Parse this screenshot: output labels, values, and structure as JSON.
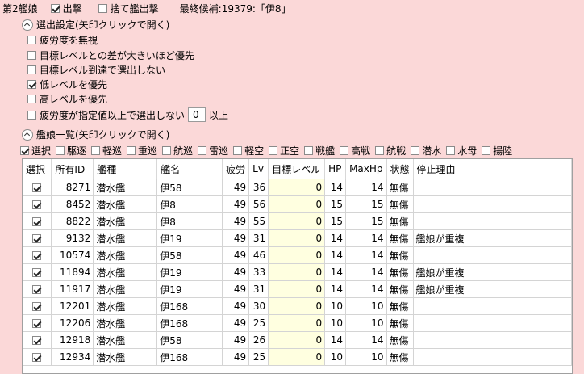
{
  "header": {
    "fleet_label": "第2艦娘",
    "sortie_label": "出撃",
    "sortie_checked": true,
    "sacrifice_label": "捨て艦出撃",
    "sacrifice_checked": false,
    "final_candidate": "最終候補:19379:「伊8」"
  },
  "selection_settings": {
    "title": "選出設定(矢印クリックで開く)",
    "options": [
      {
        "label": "疲労度を無視",
        "checked": false
      },
      {
        "label": "目標レベルとの差が大きいほど優先",
        "checked": false
      },
      {
        "label": "目標レベル到達で選出しない",
        "checked": false
      },
      {
        "label": "低レベルを優先",
        "checked": true
      },
      {
        "label": "高レベルを優先",
        "checked": false
      }
    ],
    "fatigue_option_label": "疲労度が指定値以上で選出しない",
    "fatigue_option_checked": false,
    "fatigue_value": "0",
    "fatigue_suffix": "以上"
  },
  "ship_list": {
    "title": "艦娘一覧(矢印クリックで開く)",
    "filters": [
      {
        "label": "選択",
        "checked": true
      },
      {
        "label": "駆逐",
        "checked": false
      },
      {
        "label": "軽巡",
        "checked": false
      },
      {
        "label": "重巡",
        "checked": false
      },
      {
        "label": "航巡",
        "checked": false
      },
      {
        "label": "雷巡",
        "checked": false
      },
      {
        "label": "軽空",
        "checked": false
      },
      {
        "label": "正空",
        "checked": false
      },
      {
        "label": "戦艦",
        "checked": false
      },
      {
        "label": "高戦",
        "checked": false
      },
      {
        "label": "航戦",
        "checked": false
      },
      {
        "label": "潜水",
        "checked": false
      },
      {
        "label": "水母",
        "checked": false
      },
      {
        "label": "揚陸",
        "checked": false
      }
    ]
  },
  "table": {
    "columns": [
      "選択",
      "所有ID",
      "艦種",
      "艦名",
      "疲労",
      "Lv",
      "目標レベル",
      "HP",
      "MaxHp",
      "状態",
      "停止理由"
    ],
    "rows": [
      {
        "selected": true,
        "id": "8271",
        "type": "潜水艦",
        "name": "伊58",
        "fatigue": "49",
        "lv": "36",
        "target": "0",
        "hp": "14",
        "maxhp": "14",
        "status": "無傷",
        "reason": ""
      },
      {
        "selected": true,
        "id": "8452",
        "type": "潜水艦",
        "name": "伊8",
        "fatigue": "49",
        "lv": "56",
        "target": "0",
        "hp": "15",
        "maxhp": "15",
        "status": "無傷",
        "reason": ""
      },
      {
        "selected": true,
        "id": "8822",
        "type": "潜水艦",
        "name": "伊8",
        "fatigue": "49",
        "lv": "55",
        "target": "0",
        "hp": "15",
        "maxhp": "15",
        "status": "無傷",
        "reason": ""
      },
      {
        "selected": true,
        "id": "9132",
        "type": "潜水艦",
        "name": "伊19",
        "fatigue": "49",
        "lv": "31",
        "target": "0",
        "hp": "14",
        "maxhp": "14",
        "status": "無傷",
        "reason": "艦娘が重複"
      },
      {
        "selected": true,
        "id": "10574",
        "type": "潜水艦",
        "name": "伊58",
        "fatigue": "49",
        "lv": "46",
        "target": "0",
        "hp": "14",
        "maxhp": "14",
        "status": "無傷",
        "reason": ""
      },
      {
        "selected": true,
        "id": "11894",
        "type": "潜水艦",
        "name": "伊19",
        "fatigue": "49",
        "lv": "33",
        "target": "0",
        "hp": "14",
        "maxhp": "14",
        "status": "無傷",
        "reason": "艦娘が重複"
      },
      {
        "selected": true,
        "id": "11917",
        "type": "潜水艦",
        "name": "伊19",
        "fatigue": "49",
        "lv": "31",
        "target": "0",
        "hp": "14",
        "maxhp": "14",
        "status": "無傷",
        "reason": "艦娘が重複"
      },
      {
        "selected": true,
        "id": "12201",
        "type": "潜水艦",
        "name": "伊168",
        "fatigue": "49",
        "lv": "30",
        "target": "0",
        "hp": "10",
        "maxhp": "10",
        "status": "無傷",
        "reason": ""
      },
      {
        "selected": true,
        "id": "12206",
        "type": "潜水艦",
        "name": "伊168",
        "fatigue": "49",
        "lv": "25",
        "target": "0",
        "hp": "10",
        "maxhp": "10",
        "status": "無傷",
        "reason": ""
      },
      {
        "selected": true,
        "id": "12918",
        "type": "潜水艦",
        "name": "伊58",
        "fatigue": "49",
        "lv": "26",
        "target": "0",
        "hp": "14",
        "maxhp": "14",
        "status": "無傷",
        "reason": ""
      },
      {
        "selected": true,
        "id": "12934",
        "type": "潜水艦",
        "name": "伊168",
        "fatigue": "49",
        "lv": "25",
        "target": "0",
        "hp": "10",
        "maxhp": "10",
        "status": "無傷",
        "reason": ""
      }
    ]
  }
}
